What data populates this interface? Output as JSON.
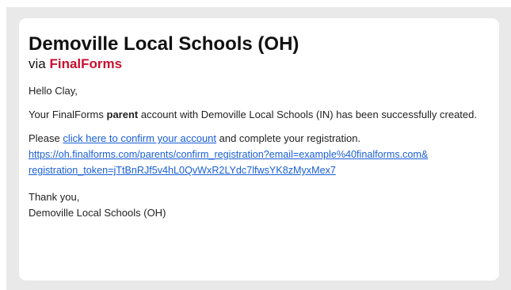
{
  "email": {
    "title": "Demoville Local Schools (OH)",
    "via_prefix": "via ",
    "brand": "FinalForms",
    "greeting": "Hello Clay,",
    "para1": {
      "before": "Your FinalForms ",
      "bold": "parent",
      "after": " account with Demoville Local Schools (IN) has been successfully created."
    },
    "para2": {
      "before": "Please ",
      "link_text": "click here to confirm your account",
      "after": " and complete your registration.",
      "url_line1": "https://oh.finalforms.com/parents/confirm_registration?email=example%40finalforms.com&",
      "url_line2": "registration_token=jTtBnRJf5v4hL0QvWxR2LYdc7lfwsYK8zMyxMex7"
    },
    "signoff": "Thank you,",
    "signature": "Demoville Local Schools (OH)"
  },
  "colors": {
    "brand": "#c8102e",
    "link": "#1a5fd6",
    "background": "#e9e9e9"
  }
}
